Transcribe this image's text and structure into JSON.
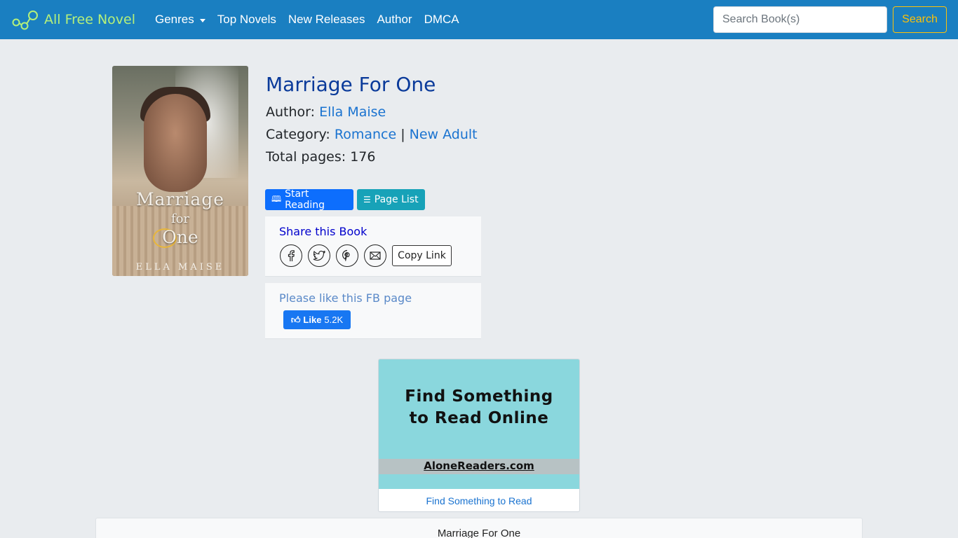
{
  "navbar": {
    "brand": "All Free Novel",
    "links": [
      "Genres",
      "Top Novels",
      "New Releases",
      "Author",
      "DMCA"
    ],
    "search_placeholder": "Search Book(s)",
    "search_button": "Search"
  },
  "cover": {
    "title_line1": "Marriage",
    "title_line2": "for",
    "title_line3": "One",
    "author": "ELLA MAISE"
  },
  "book": {
    "title": "Marriage For One",
    "author_label": "Author: ",
    "author": "Ella Maise",
    "category_label": "Category: ",
    "categories": [
      "Romance",
      "New Adult"
    ],
    "category_separator": " | ",
    "pages_label": "Total pages: ",
    "pages": "176"
  },
  "actions": {
    "start_reading": "Start Reading",
    "page_list": "Page List"
  },
  "share": {
    "title": "Share this Book",
    "copy_link": "Copy Link"
  },
  "fb": {
    "title": "Please like this FB page",
    "like": "Like",
    "count": "5.2K"
  },
  "ad": {
    "headline_line1": "Find Something",
    "headline_line2": "to Read Online",
    "site": "AloneReaders.com",
    "caption": "Find Something to Read"
  },
  "footer_card": {
    "title": "Marriage For One"
  },
  "colors": {
    "navbar": "#1a7fc1",
    "brand_text": "#b5f07a",
    "search_button": "#ffc107",
    "start_reading": "#0d6efd",
    "page_list": "#17a2b8",
    "link": "#1a73d0"
  }
}
